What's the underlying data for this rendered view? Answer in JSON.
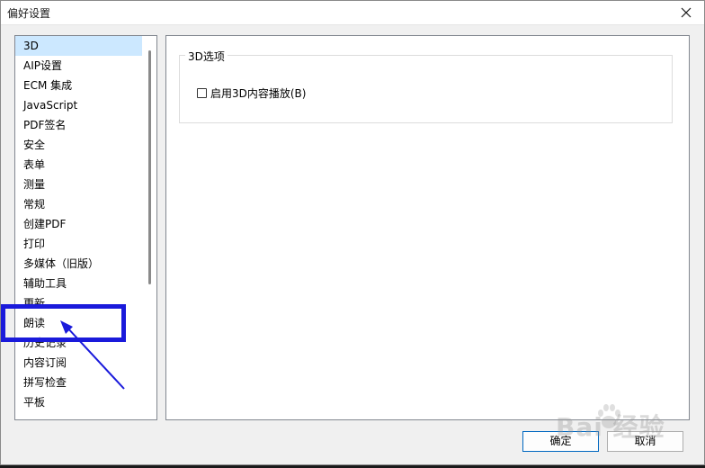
{
  "window": {
    "title": "偏好设置",
    "close_icon": "close-icon"
  },
  "categories": [
    {
      "label": "3D",
      "selected": true
    },
    {
      "label": "AIP设置",
      "selected": false
    },
    {
      "label": "ECM 集成",
      "selected": false
    },
    {
      "label": "JavaScript",
      "selected": false
    },
    {
      "label": "PDF签名",
      "selected": false
    },
    {
      "label": "安全",
      "selected": false
    },
    {
      "label": "表单",
      "selected": false
    },
    {
      "label": "测量",
      "selected": false
    },
    {
      "label": "常规",
      "selected": false
    },
    {
      "label": "创建PDF",
      "selected": false
    },
    {
      "label": "打印",
      "selected": false
    },
    {
      "label": "多媒体（旧版）",
      "selected": false
    },
    {
      "label": "辅助工具",
      "selected": false
    },
    {
      "label": "更新",
      "selected": false
    },
    {
      "label": "朗读",
      "selected": false
    },
    {
      "label": "历史记录",
      "selected": false
    },
    {
      "label": "内容订阅",
      "selected": false
    },
    {
      "label": "拼写检查",
      "selected": false
    },
    {
      "label": "平板",
      "selected": false
    },
    {
      "label": "",
      "selected": false
    }
  ],
  "options_group": {
    "title": "3D选项",
    "checkbox_label": "启用3D内容播放(B)",
    "checked": false
  },
  "buttons": {
    "ok": "确定",
    "cancel": "取消"
  },
  "annotation": {
    "color": "#1a1adb",
    "target_item": "朗读"
  },
  "watermark": {
    "text": "Bai 经验"
  }
}
